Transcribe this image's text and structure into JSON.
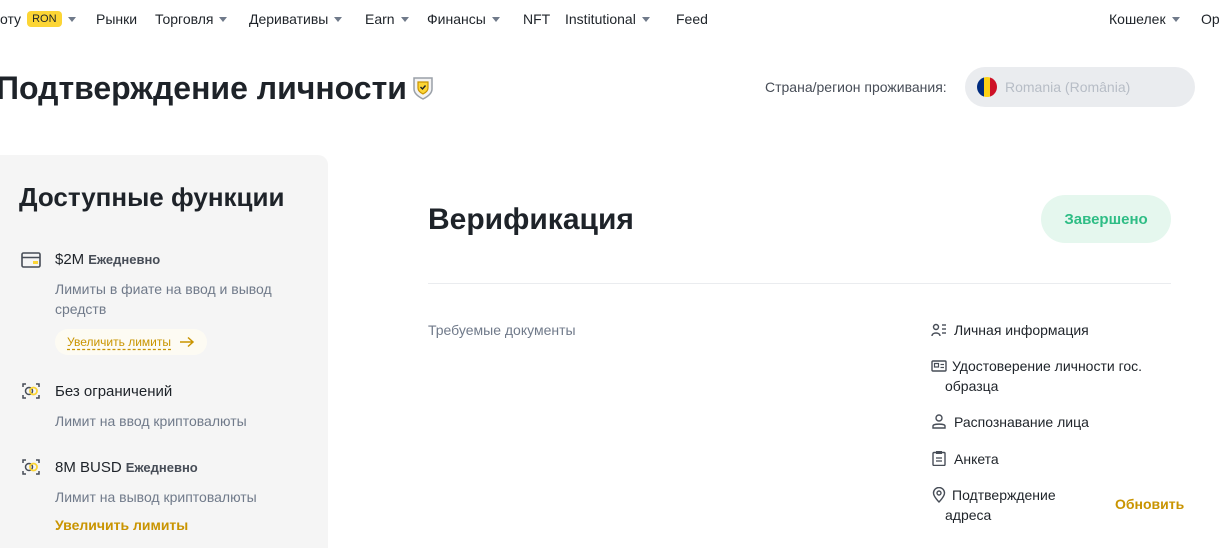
{
  "nav": {
    "partial_left": "оту",
    "currency_badge": "RON",
    "markets": "Рынки",
    "trade": "Торговля",
    "derivatives": "Деривативы",
    "earn": "Earn",
    "finance": "Финансы",
    "nft": "NFT",
    "institutional": "Institutional",
    "feed": "Feed",
    "wallet": "Кошелек",
    "partial_right": "Ор"
  },
  "header": {
    "title": "Подтверждение личности",
    "country_label": "Страна/регион проживания:",
    "country_value": "Romania (România)",
    "flag_colors": [
      "#002b7f",
      "#fcd116",
      "#ce1126"
    ]
  },
  "features": {
    "title": "Доступные функции",
    "items": [
      {
        "icon": "card-icon",
        "amount": "$2M",
        "period": "Ежедневно",
        "description": "Лимиты в фиате на ввод и вывод средств",
        "action": "Увеличить лимиты"
      },
      {
        "icon": "crypto-deposit-icon",
        "amount": "Без ограничений",
        "period": "",
        "description": "Лимит на ввод криптовалюты"
      },
      {
        "icon": "crypto-withdraw-icon",
        "amount": "8M BUSD",
        "period": "Ежедневно",
        "description": "Лимит на вывод криптовалюты",
        "action": "Увеличить лимиты"
      }
    ]
  },
  "verification": {
    "title": "Верификация",
    "status": "Завершено",
    "required_label": "Требуемые документы",
    "documents": [
      {
        "icon": "personal-info-icon",
        "label": "Личная информация"
      },
      {
        "icon": "id-card-icon",
        "label": "Удостоверение личности гос. образца"
      },
      {
        "icon": "face-icon",
        "label": "Распознавание лица"
      },
      {
        "icon": "clipboard-icon",
        "label": "Анкета"
      },
      {
        "icon": "location-pin-icon",
        "label": "Подтверждение адреса"
      }
    ],
    "update_label": "Обновить"
  },
  "colors": {
    "accent": "#c99400",
    "brand_yellow": "#fcd535",
    "success": "#2ebd85",
    "success_bg": "#e5f7ee"
  }
}
